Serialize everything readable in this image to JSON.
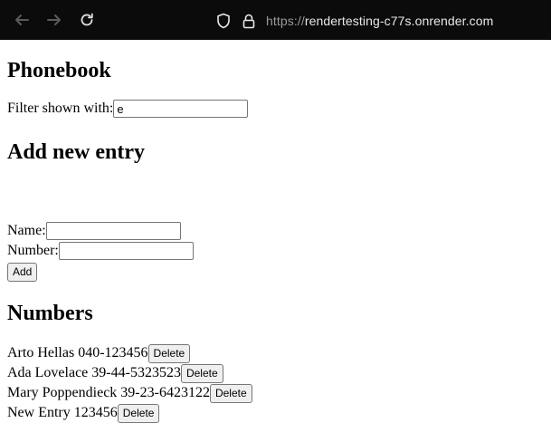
{
  "browser": {
    "url_prefix": "https://",
    "url_host": "rendertesting-c77s.onrender.com"
  },
  "page": {
    "title": "Phonebook",
    "filter": {
      "label": "Filter shown with:",
      "value": "e"
    },
    "add_section": {
      "title": "Add new entry",
      "name_label": "Name:",
      "name_value": "",
      "number_label": "Number:",
      "number_value": "",
      "add_button": "Add"
    },
    "numbers_section": {
      "title": "Numbers",
      "delete_label": "Delete",
      "entries": [
        {
          "text": "Arto Hellas 040-123456"
        },
        {
          "text": "Ada Lovelace 39-44-5323523"
        },
        {
          "text": "Mary Poppendieck 39-23-6423122"
        },
        {
          "text": "New Entry 123456"
        }
      ]
    }
  },
  "icons": {
    "back": "back-arrow-icon",
    "forward": "forward-arrow-icon",
    "reload": "reload-icon",
    "tracking": "shield-icon",
    "lock": "lock-icon"
  }
}
